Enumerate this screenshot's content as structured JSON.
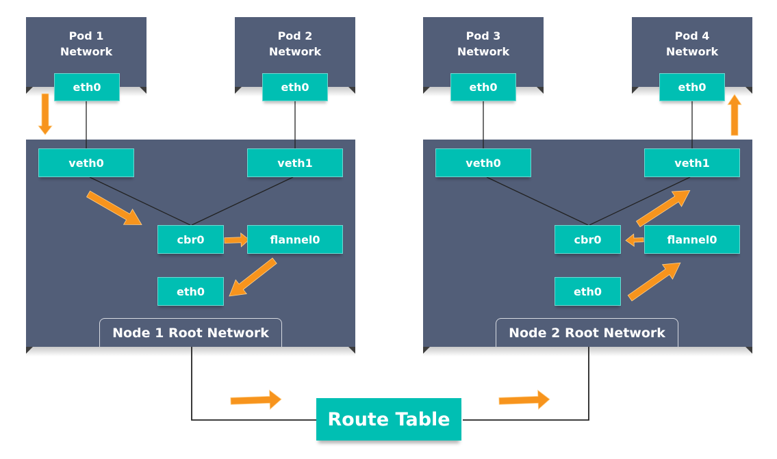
{
  "pods": [
    {
      "title_line1": "Pod 1",
      "title_line2": "Network",
      "iface": "eth0"
    },
    {
      "title_line1": "Pod 2",
      "title_line2": "Network",
      "iface": "eth0"
    },
    {
      "title_line1": "Pod 3",
      "title_line2": "Network",
      "iface": "eth0"
    },
    {
      "title_line1": "Pod 4",
      "title_line2": "Network",
      "iface": "eth0"
    }
  ],
  "nodes": [
    {
      "label": "Node 1 Root Network",
      "veth0": "veth0",
      "veth1": "veth1",
      "bridge": "cbr0",
      "overlay": "flannel0",
      "eth": "eth0"
    },
    {
      "label": "Node 2 Root Network",
      "veth0": "veth0",
      "veth1": "veth1",
      "bridge": "cbr0",
      "overlay": "flannel0",
      "eth": "eth0"
    }
  ],
  "route_table": {
    "label": "Route Table"
  },
  "colors": {
    "panel": "#525e78",
    "interface": "#00bfb3",
    "arrow": "#f7941d",
    "line": "#222222"
  }
}
